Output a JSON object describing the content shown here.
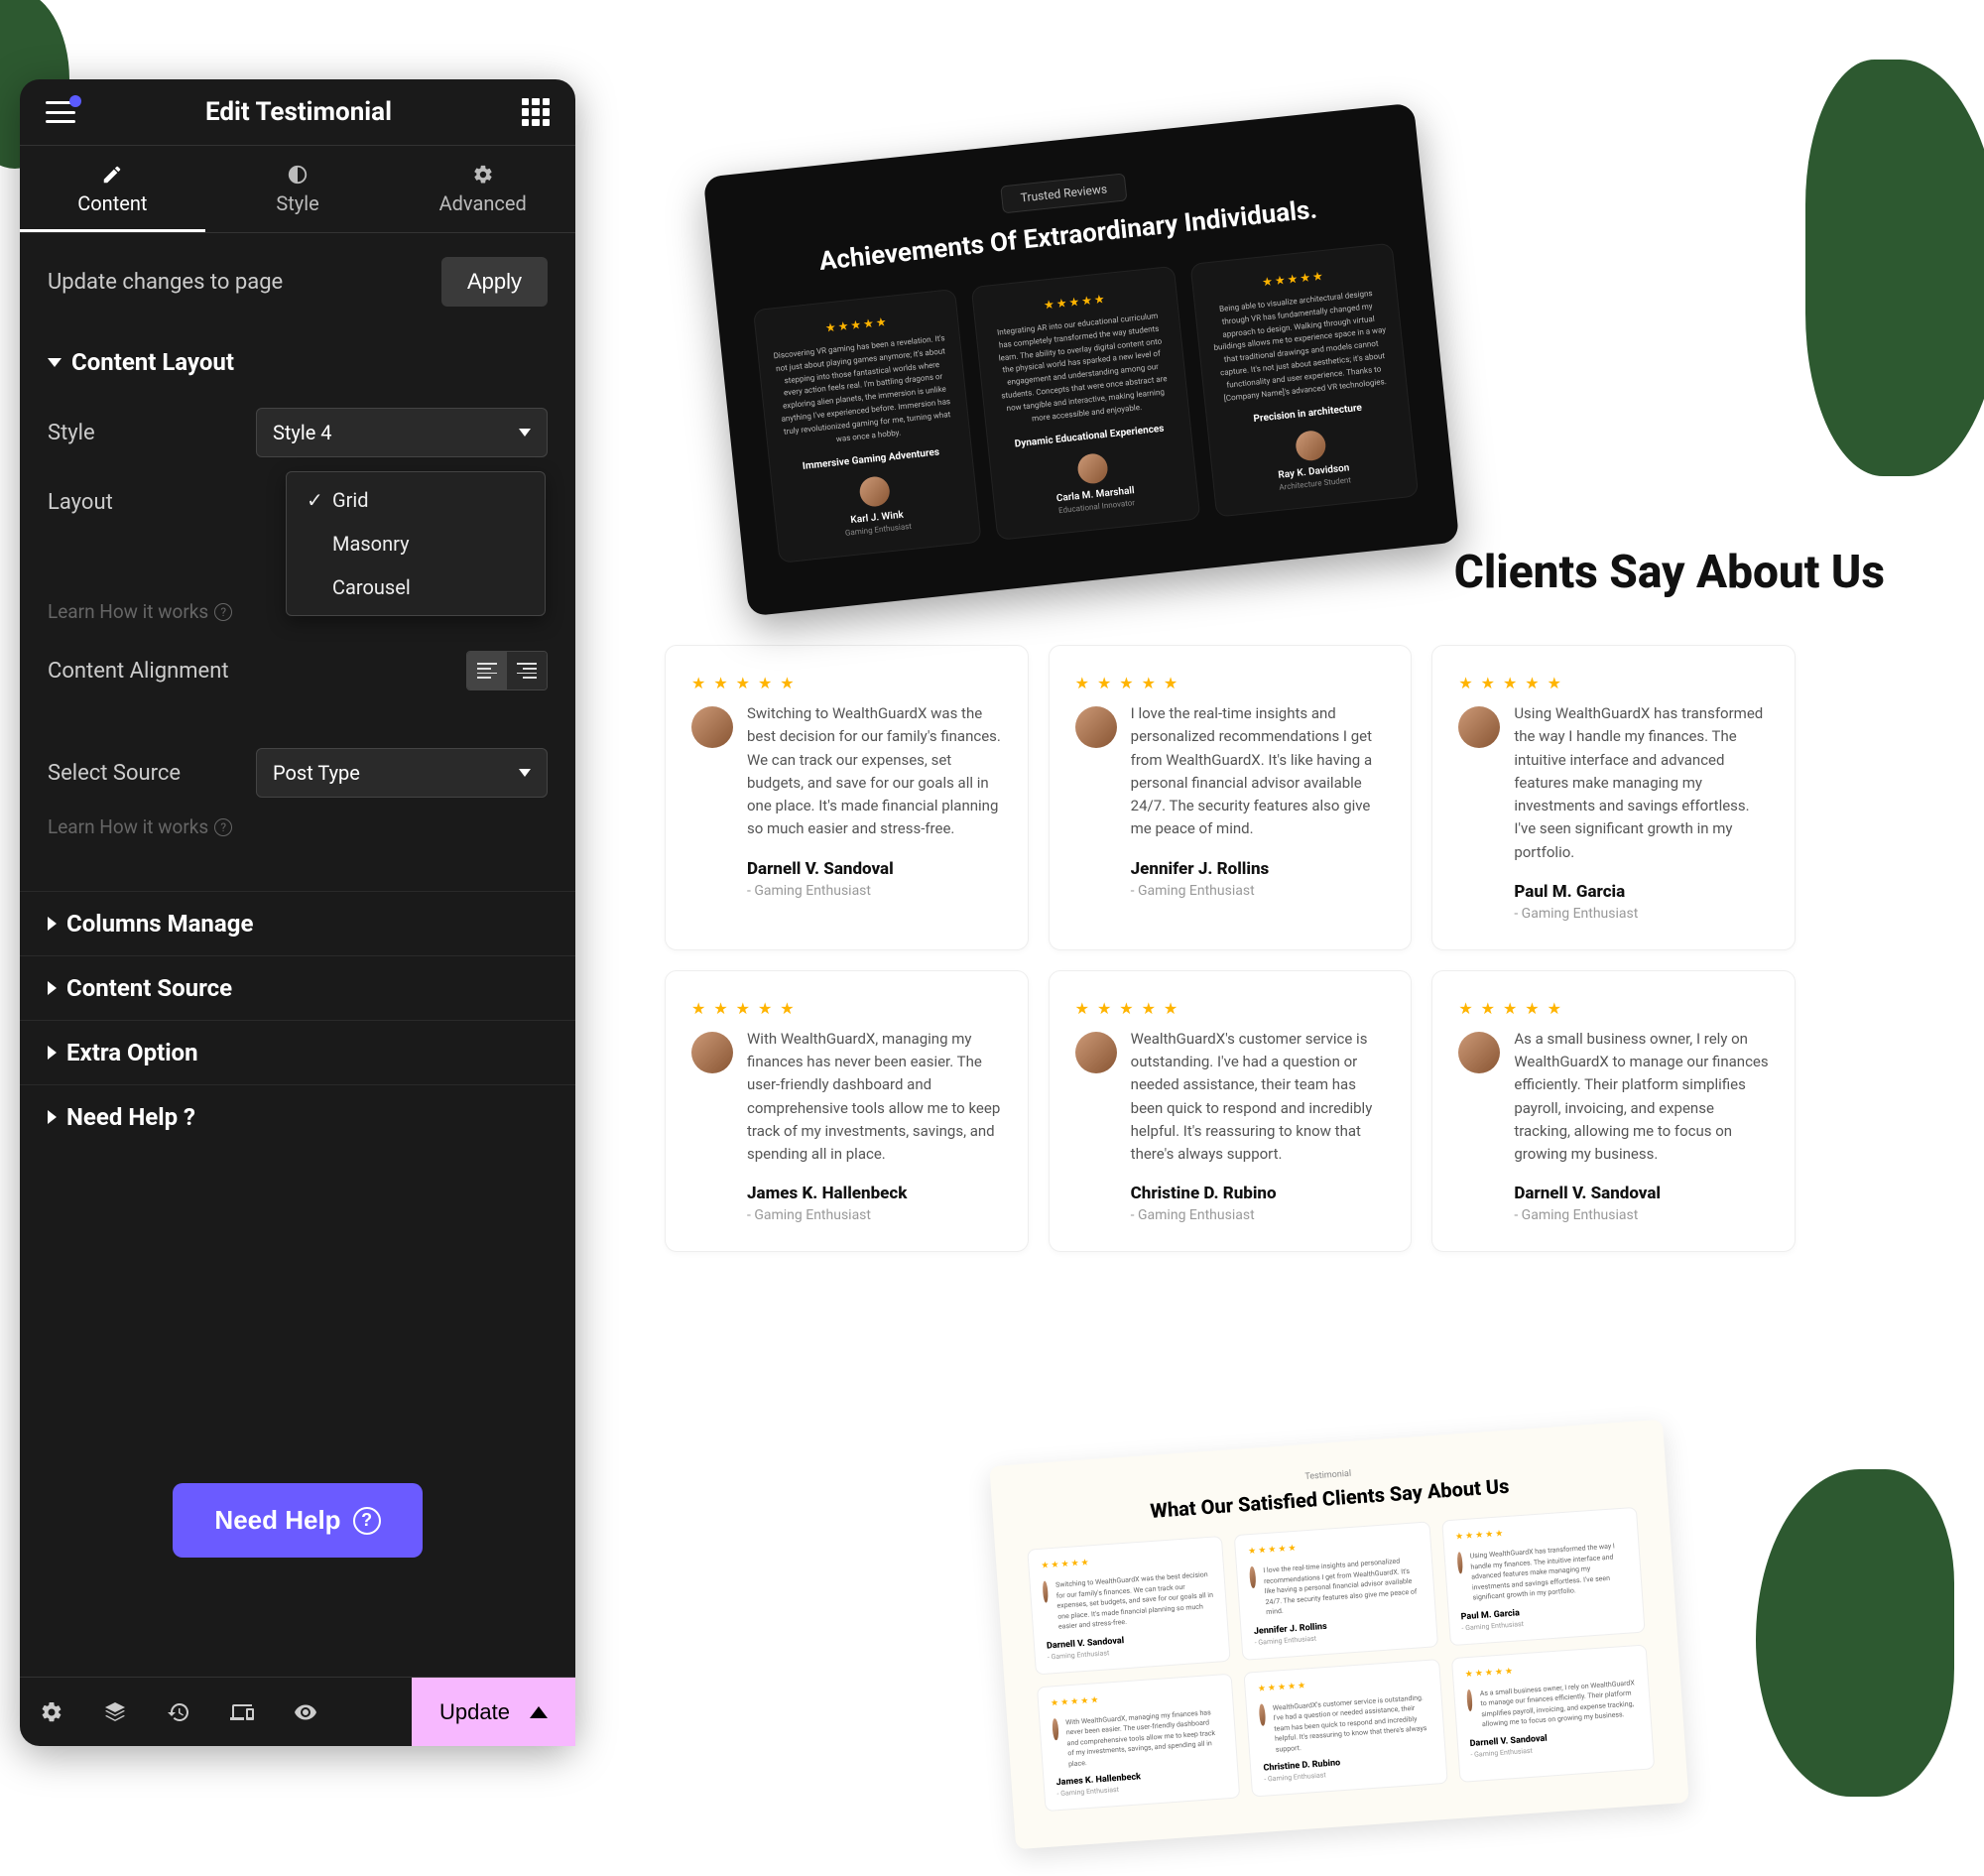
{
  "panel": {
    "title": "Edit Testimonial",
    "tabs": {
      "content": "Content",
      "style": "Style",
      "advanced": "Advanced"
    },
    "apply_row": {
      "label": "Update changes to page",
      "button": "Apply"
    },
    "content_layout": {
      "title": "Content Layout",
      "style_label": "Style",
      "style_value": "Style 4",
      "layout_label": "Layout",
      "layout_options": [
        "Grid",
        "Masonry",
        "Carousel"
      ],
      "layout_selected": "Grid",
      "hint": "Learn How it works",
      "alignment_label": "Content Alignment",
      "source_label": "Select Source",
      "source_value": "Post Type"
    },
    "sections": {
      "columns": "Columns Manage",
      "content_source": "Content Source",
      "extra": "Extra Option",
      "help": "Need Help ?"
    },
    "help_button": "Need Help",
    "footer": {
      "update": "Update"
    }
  },
  "preview": {
    "dark": {
      "badge": "Trusted Reviews",
      "title": "Achievements Of Extraordinary Individuals.",
      "items": [
        {
          "tag": "Immersive Gaming Adventures",
          "name": "Karl J. Wink",
          "role": "Gaming Enthusiast",
          "text": "Discovering VR gaming has been a revelation. It's not just about playing games anymore; it's about stepping into those fantastical worlds where every action feels real. I'm battling dragons or exploring alien planets, the immersion is unlike anything I've experienced before. Immersion has truly revolutionized gaming for me, turning what was once a hobby."
        },
        {
          "tag": "Dynamic Educational Experiences",
          "name": "Carla M. Marshall",
          "role": "Educational Innovator",
          "text": "Integrating AR into our educational curriculum has completely transformed the way students learn. The ability to overlay digital content onto the physical world has sparked a new level of engagement and understanding among our students. Concepts that were once abstract are now tangible and interactive, making learning more accessible and enjoyable."
        },
        {
          "tag": "Precision in architecture",
          "name": "Ray K. Davidson",
          "role": "Architecture Student",
          "text": "Being able to visualize architectural designs through VR has fundamentally changed my approach to design. Walking through virtual buildings allows me to experience space in a way that traditional drawings and models cannot capture. It's not just about aesthetics; it's about functionality and user experience. Thanks to [Company Name]'s advanced VR technologies."
        }
      ]
    },
    "main_title": "Clients Say About Us",
    "cards": [
      {
        "name": "Darnell V. Sandoval",
        "role": "- Gaming Enthusiast",
        "text": "Switching to WealthGuardX was the best decision for our family's finances. We can track our expenses, set budgets, and save for our goals all in one place. It's made financial planning so much easier and stress-free."
      },
      {
        "name": "Jennifer J. Rollins",
        "role": "- Gaming Enthusiast",
        "text": "I love the real-time insights and personalized recommendations I get from WealthGuardX. It's like having a personal financial advisor available 24/7. The security features also give me peace of mind."
      },
      {
        "name": "Paul M. Garcia",
        "role": "- Gaming Enthusiast",
        "text": "Using WealthGuardX has transformed the way I handle my finances. The intuitive interface and advanced features make managing my investments and savings effortless. I've seen significant growth in my portfolio."
      },
      {
        "name": "James K. Hallenbeck",
        "role": "- Gaming Enthusiast",
        "text": "With WealthGuardX, managing my finances has never been easier. The user-friendly dashboard and comprehensive tools allow me to keep track of my investments, savings, and spending all in place."
      },
      {
        "name": "Christine D. Rubino",
        "role": "- Gaming Enthusiast",
        "text": "WealthGuardX's customer service is outstanding. I've had a question or needed assistance, their team has been quick to respond and incredibly helpful. It's reassuring to know that there's always support."
      },
      {
        "name": "Darnell V. Sandoval",
        "role": "- Gaming Enthusiast",
        "text": "As a small business owner, I rely on WealthGuardX to manage our finances efficiently. Their platform simplifies payroll, invoicing, and expense tracking, allowing me to focus on growing my business."
      }
    ],
    "mini": {
      "badge": "Testimonial",
      "title": "What Our Satisfied Clients Say About Us"
    }
  }
}
